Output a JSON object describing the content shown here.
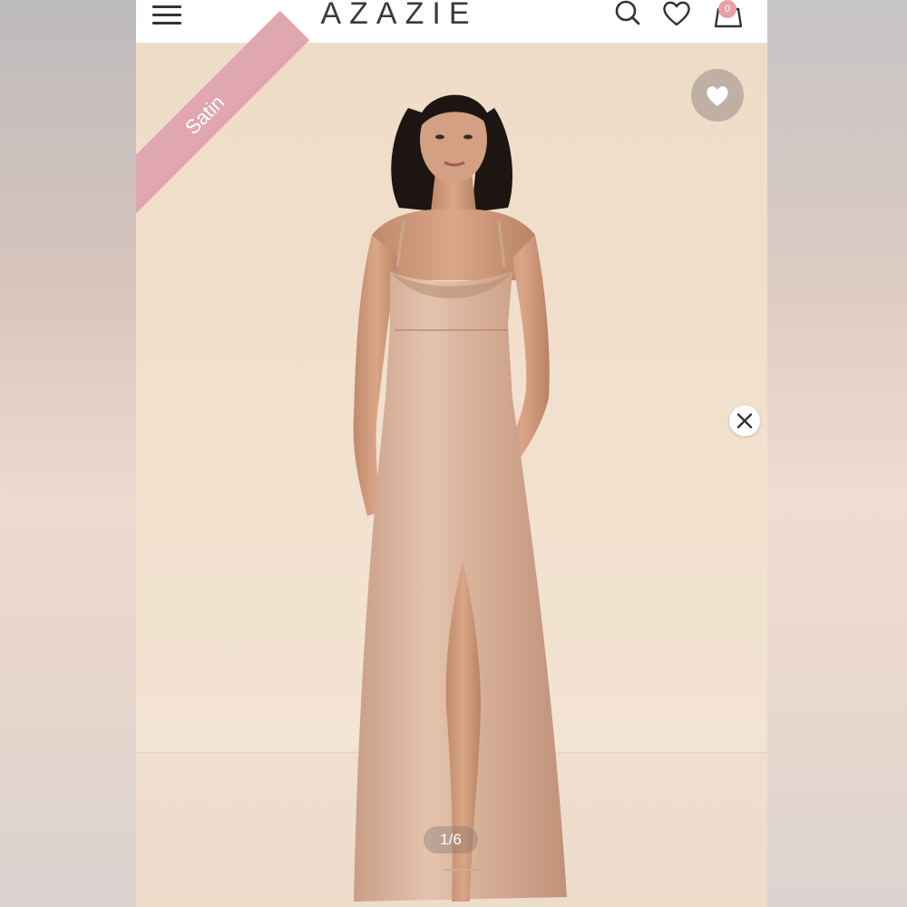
{
  "header": {
    "logo": "AZAZIE",
    "cart_count": "0",
    "icons": [
      "hamburger-menu-icon",
      "search-icon",
      "heart-icon",
      "shopping-bag-icon"
    ]
  },
  "product_image": {
    "badge": "Satin",
    "counter": "1/6",
    "icons": [
      "wishlist-heart-icon",
      "close-icon"
    ]
  },
  "colors": {
    "badge_pink": "#e1a7b1",
    "cart_badge": "#e8a0a4",
    "background": "#f1dfcb",
    "dress": "#d8b39b"
  }
}
